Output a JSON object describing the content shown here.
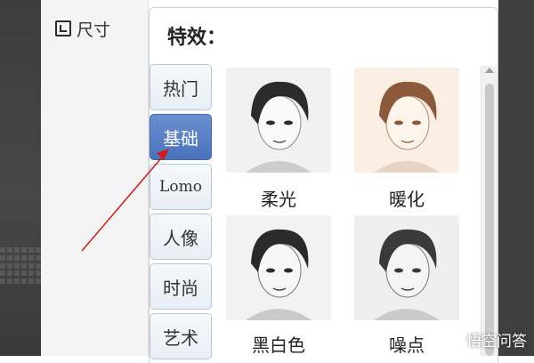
{
  "left_panel": {
    "size_label": "尺寸"
  },
  "effects": {
    "title": "特效：",
    "tabs": [
      {
        "label": "热门",
        "active": false
      },
      {
        "label": "基础",
        "active": true
      },
      {
        "label": "Lomo",
        "active": false
      },
      {
        "label": "人像",
        "active": false
      },
      {
        "label": "时尚",
        "active": false
      },
      {
        "label": "艺术",
        "active": false
      }
    ],
    "items": [
      {
        "label": "柔光",
        "tone": "#f1f1f1",
        "ink": "#2b2b2b"
      },
      {
        "label": "暖化",
        "tone": "#fbeee2",
        "ink": "#8a5a3a"
      },
      {
        "label": "黑白色",
        "tone": "#f2f2f2",
        "ink": "#2a2a2a"
      },
      {
        "label": "噪点",
        "tone": "#efefef",
        "ink": "#3a3a3a"
      }
    ]
  },
  "watermark": {
    "text": "悟空问答"
  },
  "colors": {
    "active_tab": "#4a72bd",
    "arrow": "#d01c1c",
    "panel_border": "#c9d1da"
  }
}
